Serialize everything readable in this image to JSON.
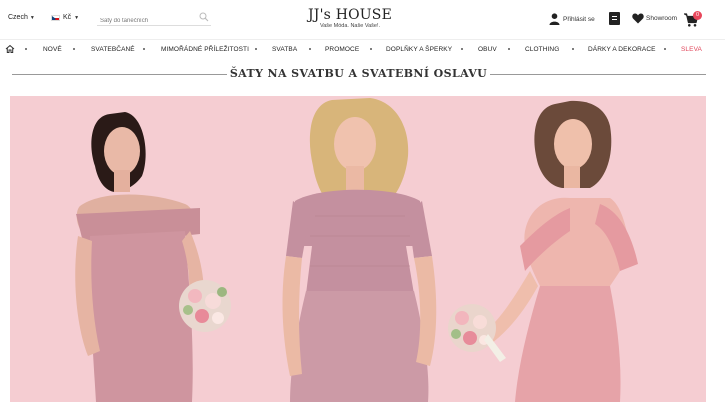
{
  "header": {
    "language": "Czech",
    "currency": "Kč",
    "search_placeholder": "Šaty do tanečních",
    "logo_name": "JJ's HOUSE",
    "logo_tagline": "Vaše Móda. Naše Vaše!.",
    "sign_in_label": "Přihlásit se",
    "showroom_label": "Showroom",
    "cart_count": "0",
    "icons": [
      "chevron-down-icon",
      "czech-flag-icon",
      "search-icon",
      "user-icon",
      "wishlist-icon",
      "heart-icon",
      "cart-icon"
    ]
  },
  "nav": {
    "home_icon": "home-icon",
    "items": [
      {
        "label": "NOVÉ"
      },
      {
        "label": "SVATEBČANÉ"
      },
      {
        "label": "MIMOŘÁDNÉ PŘÍLEŽITOSTI"
      },
      {
        "label": "SVATBA"
      },
      {
        "label": "PROMOCE"
      },
      {
        "label": "DOPLŇKY A ŠPERKY"
      },
      {
        "label": "OBUV"
      },
      {
        "label": "CLOTHING"
      },
      {
        "label": "DÁRKY A DEKORACE"
      },
      {
        "label": "SLEVA"
      }
    ],
    "sale_color": "#e0455a"
  },
  "section": {
    "title": "ŠATY NA SVATBU A SVATEBNÍ OSLAVU"
  },
  "banner": {
    "background_color": "#f5cdd2",
    "dress_color": "#d49aa6"
  }
}
